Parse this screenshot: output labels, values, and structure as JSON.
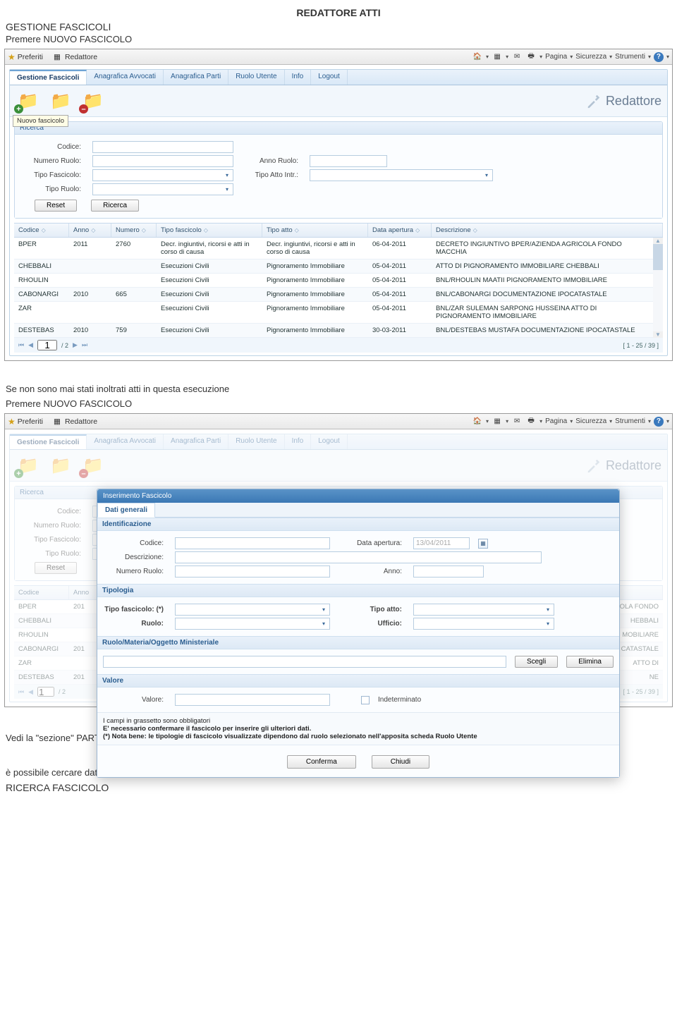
{
  "doc": {
    "title": "REDATTORE ATTI",
    "heading1": "GESTIONE FASCICOLI",
    "para1": "Premere NUOVO FASCICOLO",
    "para2a": "Se non sono mai stati inoltrati atti in questa esecuzione",
    "para2b": "Premere NUOVO FASCICOLO",
    "para3": "Vedi la \"sezione\" PARTI del file relativo all'inoltro dell'istanza di vendita",
    "para4": "è possibile cercare dati già inseriti nel fascicolo con la funzione RICERCA",
    "heading4": "RICERCA FASCICOLO"
  },
  "browser": {
    "favorites": "Preferiti",
    "tabTitle": "Redattore",
    "tools": {
      "pagina": "Pagina",
      "sicurezza": "Sicurezza",
      "strumenti": "Strumenti"
    }
  },
  "app": {
    "brand": "Redattore",
    "nav": [
      "Gestione Fascicoli",
      "Anagrafica Avvocati",
      "Anagrafica Parti",
      "Ruolo Utente",
      "Info",
      "Logout"
    ],
    "newTooltip": "Nuovo fascicolo",
    "search": {
      "panelTitle": "Ricerca",
      "codice": "Codice:",
      "numeroRuolo": "Numero Ruolo:",
      "annoRuolo": "Anno Ruolo:",
      "tipoFascicolo": "Tipo Fascicolo:",
      "tipoAttoIntr": "Tipo Atto Intr.:",
      "tipoRuolo": "Tipo Ruolo:",
      "reset": "Reset",
      "ricerca": "Ricerca"
    },
    "grid": {
      "cols": [
        "Codice",
        "Anno",
        "Numero",
        "Tipo fascicolo",
        "Tipo atto",
        "Data apertura",
        "Descrizione"
      ],
      "rows": [
        {
          "codice": "BPER",
          "anno": "2011",
          "numero": "2760",
          "tipof": "Decr. ingiuntivi, ricorsi e atti in corso di causa",
          "tipoa": "Decr. ingiuntivi, ricorsi e atti in corso di causa",
          "data": "06-04-2011",
          "desc": "DECRETO INGIUNTIVO BPER/AZIENDA AGRICOLA FONDO MACCHIA"
        },
        {
          "codice": "CHEBBALI",
          "anno": "",
          "numero": "",
          "tipof": "Esecuzioni Civili",
          "tipoa": "Pignoramento Immobiliare",
          "data": "05-04-2011",
          "desc": "ATTO DI PIGNORAMENTO IMMOBILIARE CHEBBALI"
        },
        {
          "codice": "RHOULIN",
          "anno": "",
          "numero": "",
          "tipof": "Esecuzioni Civili",
          "tipoa": "Pignoramento Immobiliare",
          "data": "05-04-2011",
          "desc": "BNL/RHOULIN MAATII PIGNORAMENTO IMMOBILIARE"
        },
        {
          "codice": "CABONARGI",
          "anno": "2010",
          "numero": "665",
          "tipof": "Esecuzioni Civili",
          "tipoa": "Pignoramento Immobiliare",
          "data": "05-04-2011",
          "desc": "BNL/CABONARGI DOCUMENTAZIONE IPOCATASTALE"
        },
        {
          "codice": "ZAR",
          "anno": "",
          "numero": "",
          "tipof": "Esecuzioni Civili",
          "tipoa": "Pignoramento Immobiliare",
          "data": "05-04-2011",
          "desc": "BNL/ZAR SULEMAN SARPONG HUSSEINA ATTO DI PIGNORAMENTO IMMOBILIARE"
        },
        {
          "codice": "DESTEBAS",
          "anno": "2010",
          "numero": "759",
          "tipof": "Esecuzioni Civili",
          "tipoa": "Pignoramento Immobiliare",
          "data": "30-03-2011",
          "desc": "BNL/DESTEBAS MUSTAFA DOCUMENTAZIONE IPOCATASTALE"
        }
      ],
      "pager": {
        "page": "1",
        "total": "/ 2",
        "range": "[ 1 - 25 / 39 ]"
      }
    }
  },
  "modal": {
    "title": "Inserimento Fascicolo",
    "tab": "Dati generali",
    "sec1": "Identificazione",
    "codice": "Codice:",
    "dataApertura": "Data apertura:",
    "dataVal": "13/04/2011",
    "descrizione": "Descrizione:",
    "numeroRuolo": "Numero Ruolo:",
    "anno": "Anno:",
    "sec2": "Tipologia",
    "tipoFascicolo": "Tipo fascicolo: (*)",
    "tipoAtto": "Tipo atto:",
    "ruolo": "Ruolo:",
    "ufficio": "Ufficio:",
    "sec3": "Ruolo/Materia/Oggetto Ministeriale",
    "scegli": "Scegli",
    "elimina": "Elimina",
    "sec4": "Valore",
    "valore": "Valore:",
    "indet": "Indeterminato",
    "note1": "I campi in grassetto sono obbligatori",
    "note2": "E' necessario confermare il fascicolo per inserire gli ulteriori dati.",
    "note3": "(*) Nota bene: le tipologie di fascicolo visualizzate dipendono dal ruolo selezionato nell'apposita scheda Ruolo Utente",
    "conferma": "Conferma",
    "chiudi": "Chiudi"
  },
  "bgGrid": {
    "rows": [
      "BPER",
      "CHEBBALI",
      "RHOULIN",
      "CABONARGI",
      "ZAR",
      "DESTEBAS"
    ],
    "anni": [
      "201",
      "",
      "",
      "201",
      "",
      "201"
    ],
    "descTail": [
      "RICOLA FONDO",
      "HEBBALI",
      "MOBILIARE",
      "CATASTALE",
      "ATTO DI",
      "NE"
    ],
    "pagerRange": "[ 1 - 25 / 39 ]"
  }
}
